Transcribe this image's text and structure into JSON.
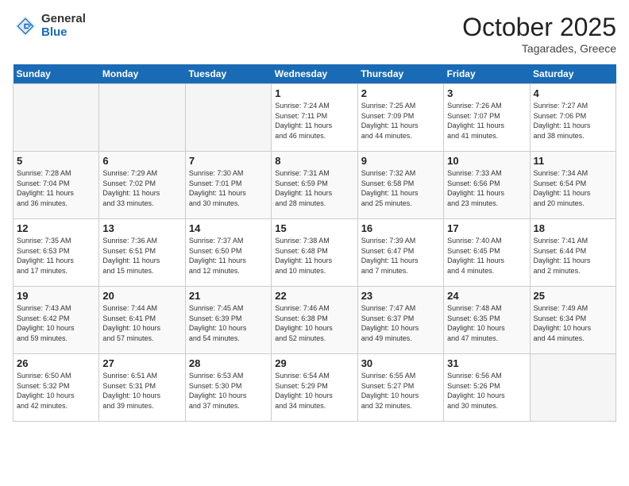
{
  "header": {
    "logo_general": "General",
    "logo_blue": "Blue",
    "month": "October 2025",
    "location": "Tagarades, Greece"
  },
  "days_of_week": [
    "Sunday",
    "Monday",
    "Tuesday",
    "Wednesday",
    "Thursday",
    "Friday",
    "Saturday"
  ],
  "weeks": [
    [
      {
        "num": "",
        "info": ""
      },
      {
        "num": "",
        "info": ""
      },
      {
        "num": "",
        "info": ""
      },
      {
        "num": "1",
        "info": "Sunrise: 7:24 AM\nSunset: 7:11 PM\nDaylight: 11 hours\nand 46 minutes."
      },
      {
        "num": "2",
        "info": "Sunrise: 7:25 AM\nSunset: 7:09 PM\nDaylight: 11 hours\nand 44 minutes."
      },
      {
        "num": "3",
        "info": "Sunrise: 7:26 AM\nSunset: 7:07 PM\nDaylight: 11 hours\nand 41 minutes."
      },
      {
        "num": "4",
        "info": "Sunrise: 7:27 AM\nSunset: 7:06 PM\nDaylight: 11 hours\nand 38 minutes."
      }
    ],
    [
      {
        "num": "5",
        "info": "Sunrise: 7:28 AM\nSunset: 7:04 PM\nDaylight: 11 hours\nand 36 minutes."
      },
      {
        "num": "6",
        "info": "Sunrise: 7:29 AM\nSunset: 7:02 PM\nDaylight: 11 hours\nand 33 minutes."
      },
      {
        "num": "7",
        "info": "Sunrise: 7:30 AM\nSunset: 7:01 PM\nDaylight: 11 hours\nand 30 minutes."
      },
      {
        "num": "8",
        "info": "Sunrise: 7:31 AM\nSunset: 6:59 PM\nDaylight: 11 hours\nand 28 minutes."
      },
      {
        "num": "9",
        "info": "Sunrise: 7:32 AM\nSunset: 6:58 PM\nDaylight: 11 hours\nand 25 minutes."
      },
      {
        "num": "10",
        "info": "Sunrise: 7:33 AM\nSunset: 6:56 PM\nDaylight: 11 hours\nand 23 minutes."
      },
      {
        "num": "11",
        "info": "Sunrise: 7:34 AM\nSunset: 6:54 PM\nDaylight: 11 hours\nand 20 minutes."
      }
    ],
    [
      {
        "num": "12",
        "info": "Sunrise: 7:35 AM\nSunset: 6:53 PM\nDaylight: 11 hours\nand 17 minutes."
      },
      {
        "num": "13",
        "info": "Sunrise: 7:36 AM\nSunset: 6:51 PM\nDaylight: 11 hours\nand 15 minutes."
      },
      {
        "num": "14",
        "info": "Sunrise: 7:37 AM\nSunset: 6:50 PM\nDaylight: 11 hours\nand 12 minutes."
      },
      {
        "num": "15",
        "info": "Sunrise: 7:38 AM\nSunset: 6:48 PM\nDaylight: 11 hours\nand 10 minutes."
      },
      {
        "num": "16",
        "info": "Sunrise: 7:39 AM\nSunset: 6:47 PM\nDaylight: 11 hours\nand 7 minutes."
      },
      {
        "num": "17",
        "info": "Sunrise: 7:40 AM\nSunset: 6:45 PM\nDaylight: 11 hours\nand 4 minutes."
      },
      {
        "num": "18",
        "info": "Sunrise: 7:41 AM\nSunset: 6:44 PM\nDaylight: 11 hours\nand 2 minutes."
      }
    ],
    [
      {
        "num": "19",
        "info": "Sunrise: 7:43 AM\nSunset: 6:42 PM\nDaylight: 10 hours\nand 59 minutes."
      },
      {
        "num": "20",
        "info": "Sunrise: 7:44 AM\nSunset: 6:41 PM\nDaylight: 10 hours\nand 57 minutes."
      },
      {
        "num": "21",
        "info": "Sunrise: 7:45 AM\nSunset: 6:39 PM\nDaylight: 10 hours\nand 54 minutes."
      },
      {
        "num": "22",
        "info": "Sunrise: 7:46 AM\nSunset: 6:38 PM\nDaylight: 10 hours\nand 52 minutes."
      },
      {
        "num": "23",
        "info": "Sunrise: 7:47 AM\nSunset: 6:37 PM\nDaylight: 10 hours\nand 49 minutes."
      },
      {
        "num": "24",
        "info": "Sunrise: 7:48 AM\nSunset: 6:35 PM\nDaylight: 10 hours\nand 47 minutes."
      },
      {
        "num": "25",
        "info": "Sunrise: 7:49 AM\nSunset: 6:34 PM\nDaylight: 10 hours\nand 44 minutes."
      }
    ],
    [
      {
        "num": "26",
        "info": "Sunrise: 6:50 AM\nSunset: 5:32 PM\nDaylight: 10 hours\nand 42 minutes."
      },
      {
        "num": "27",
        "info": "Sunrise: 6:51 AM\nSunset: 5:31 PM\nDaylight: 10 hours\nand 39 minutes."
      },
      {
        "num": "28",
        "info": "Sunrise: 6:53 AM\nSunset: 5:30 PM\nDaylight: 10 hours\nand 37 minutes."
      },
      {
        "num": "29",
        "info": "Sunrise: 6:54 AM\nSunset: 5:29 PM\nDaylight: 10 hours\nand 34 minutes."
      },
      {
        "num": "30",
        "info": "Sunrise: 6:55 AM\nSunset: 5:27 PM\nDaylight: 10 hours\nand 32 minutes."
      },
      {
        "num": "31",
        "info": "Sunrise: 6:56 AM\nSunset: 5:26 PM\nDaylight: 10 hours\nand 30 minutes."
      },
      {
        "num": "",
        "info": ""
      }
    ]
  ]
}
